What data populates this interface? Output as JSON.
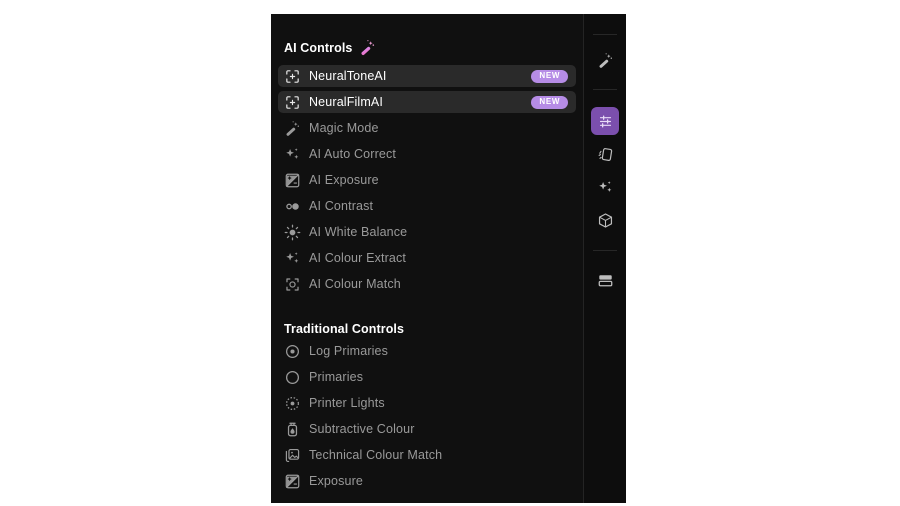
{
  "panel": {
    "ai_section": {
      "title": "AI Controls",
      "title_icon": "magic-wand-icon",
      "items": [
        {
          "label": "NeuralToneAI",
          "icon": "add-frame-icon",
          "highlighted": true,
          "badge": "NEW"
        },
        {
          "label": "NeuralFilmAI",
          "icon": "add-frame-icon",
          "highlighted": true,
          "badge": "NEW"
        },
        {
          "label": "Magic Mode",
          "icon": "magic-wand-icon",
          "highlighted": false,
          "badge": ""
        },
        {
          "label": "AI Auto Correct",
          "icon": "sparkles-icon",
          "highlighted": false,
          "badge": ""
        },
        {
          "label": "AI Exposure",
          "icon": "exposure-icon",
          "highlighted": false,
          "badge": ""
        },
        {
          "label": "AI Contrast",
          "icon": "contrast-dots-icon",
          "highlighted": false,
          "badge": ""
        },
        {
          "label": "AI White Balance",
          "icon": "sun-icon",
          "highlighted": false,
          "badge": ""
        },
        {
          "label": "AI Colour Extract",
          "icon": "sparkles-icon",
          "highlighted": false,
          "badge": ""
        },
        {
          "label": "AI Colour Match",
          "icon": "colour-match-icon",
          "highlighted": false,
          "badge": ""
        }
      ]
    },
    "traditional_section": {
      "title": "Traditional Controls",
      "items": [
        {
          "label": "Log Primaries",
          "icon": "target-dot-icon"
        },
        {
          "label": "Primaries",
          "icon": "circle-icon"
        },
        {
          "label": "Printer Lights",
          "icon": "dashed-circle-dot-icon"
        },
        {
          "label": "Subtractive Colour",
          "icon": "ink-bottle-icon"
        },
        {
          "label": "Technical Colour Match",
          "icon": "image-stack-icon"
        },
        {
          "label": "Exposure",
          "icon": "exposure-icon"
        }
      ]
    }
  },
  "rail": {
    "buttons": [
      {
        "icon": "magic-wand-icon",
        "name": "rail-magic-wand",
        "active": false
      },
      {
        "icon": "sliders-icon",
        "name": "rail-sliders",
        "active": true
      },
      {
        "icon": "film-card-icon",
        "name": "rail-film-card",
        "active": false
      },
      {
        "icon": "sparkles-icon",
        "name": "rail-sparkles",
        "active": false
      },
      {
        "icon": "cube-icon",
        "name": "rail-cube",
        "active": false
      },
      {
        "icon": "layout-panel-icon",
        "name": "rail-layout",
        "active": false
      }
    ]
  },
  "colors": {
    "panel_bg": "#101010",
    "rail_bg": "#0d0d0d",
    "row_highlight": "#2a2a2a",
    "badge": "#b68ce6",
    "accent_active": "#7b4fad",
    "text_primary": "#ffffff",
    "text_muted": "#9a9a9a"
  }
}
